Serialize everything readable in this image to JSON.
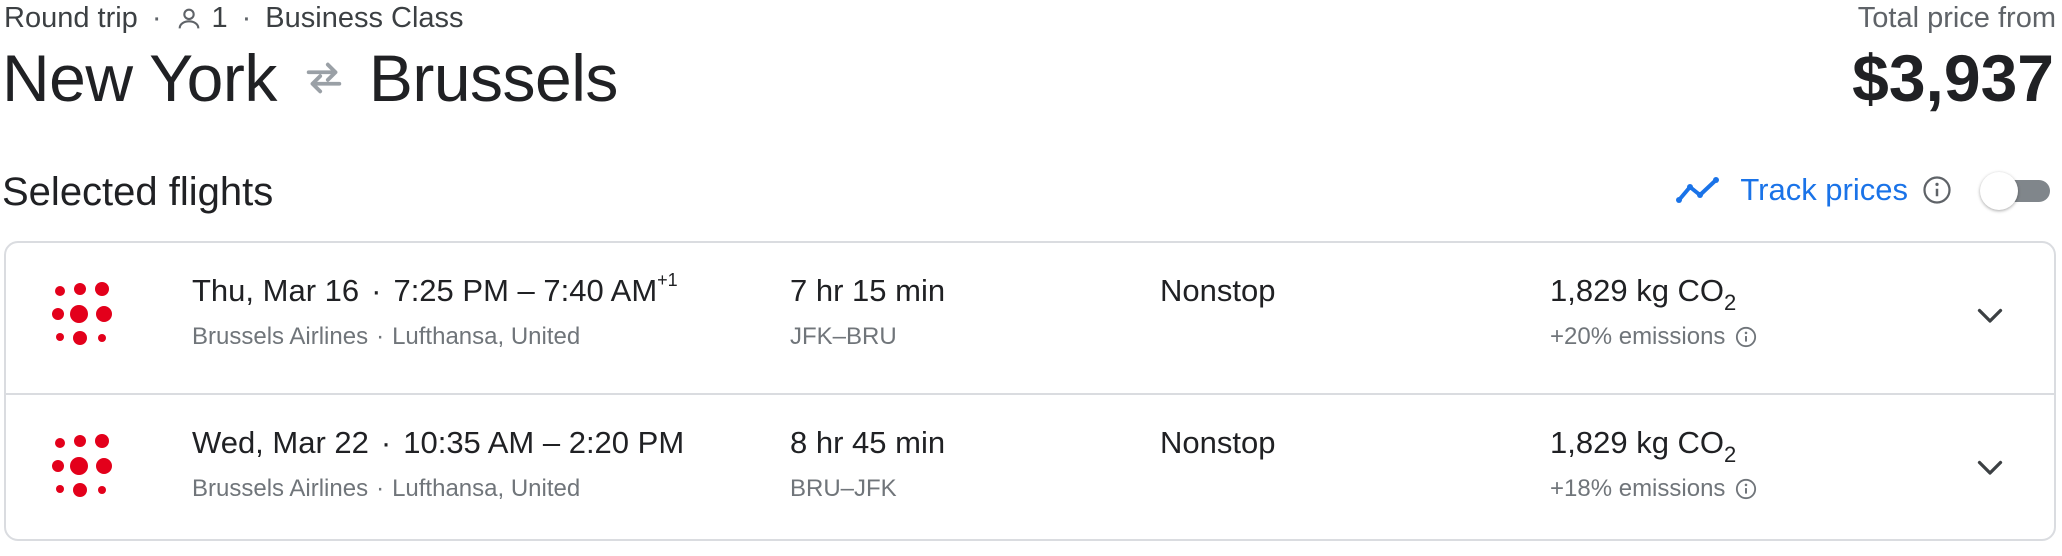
{
  "header": {
    "trip_type": "Round trip",
    "passengers": "1",
    "cabin_class": "Business Class",
    "origin": "New York",
    "destination": "Brussels",
    "total_label": "Total price from",
    "total_price": "$3,937"
  },
  "section": {
    "title": "Selected flights",
    "track_prices_label": "Track prices",
    "track_prices_enabled": false
  },
  "colors": {
    "accent": "#1a73e8",
    "airline_logo": "#e3001b",
    "text_primary": "#202124",
    "text_secondary": "#70757a",
    "border": "#dadce0"
  },
  "flights": [
    {
      "date": "Thu, Mar 16",
      "depart": "7:25 PM",
      "dash": "–",
      "arrive": "7:40 AM",
      "day_offset": "+1",
      "airline": "Brussels Airlines",
      "partners": "Lufthansa, United",
      "duration": "7 hr 15 min",
      "airports": "JFK–BRU",
      "stops": "Nonstop",
      "co2_value": "1,829 kg CO",
      "co2_sub": "2",
      "emissions": "+20% emissions",
      "logo_icon": "brussels-airlines-logo-icon"
    },
    {
      "date": "Wed, Mar 22",
      "depart": "10:35 AM",
      "dash": "–",
      "arrive": "2:20 PM",
      "day_offset": "",
      "airline": "Brussels Airlines",
      "partners": "Lufthansa, United",
      "duration": "8 hr 45 min",
      "airports": "BRU–JFK",
      "stops": "Nonstop",
      "co2_value": "1,829 kg CO",
      "co2_sub": "2",
      "emissions": "+18% emissions",
      "logo_icon": "brussels-airlines-logo-icon"
    }
  ]
}
